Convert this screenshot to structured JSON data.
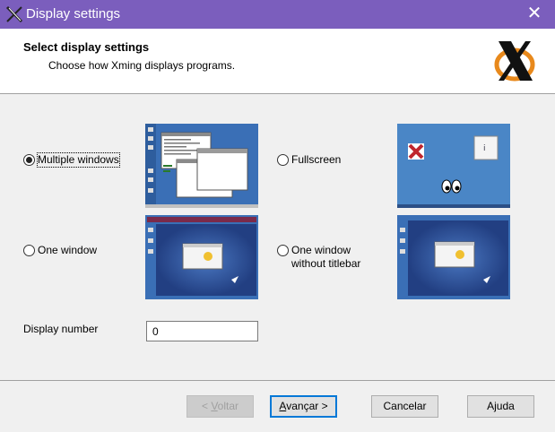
{
  "window": {
    "title": "Display settings",
    "close_glyph": "✕"
  },
  "header": {
    "title": "Select display settings",
    "subtitle": "Choose how Xming displays programs.",
    "logo_icon": "xming-logo"
  },
  "options": [
    {
      "id": "multiple",
      "label": "Multiple windows",
      "checked": true
    },
    {
      "id": "fullscreen",
      "label": "Fullscreen",
      "checked": false
    },
    {
      "id": "one-window",
      "label": "One window",
      "checked": false
    },
    {
      "id": "one-window-no-titlebar",
      "label_line1": "One window",
      "label_line2": "without titlebar",
      "checked": false
    }
  ],
  "display_number": {
    "label": "Display number",
    "value": "0"
  },
  "buttons": {
    "back": {
      "prefix": "< ",
      "mnemonic": "V",
      "rest": "oltar",
      "disabled": true
    },
    "next": {
      "mnemonic": "A",
      "rest": "vançar >",
      "default": true
    },
    "cancel": "Cancelar",
    "help": "Ajuda"
  },
  "colors": {
    "titlebar": "#7b5ebd",
    "desktop_blue": "#3a6fb6",
    "accent": "#0078d7"
  }
}
